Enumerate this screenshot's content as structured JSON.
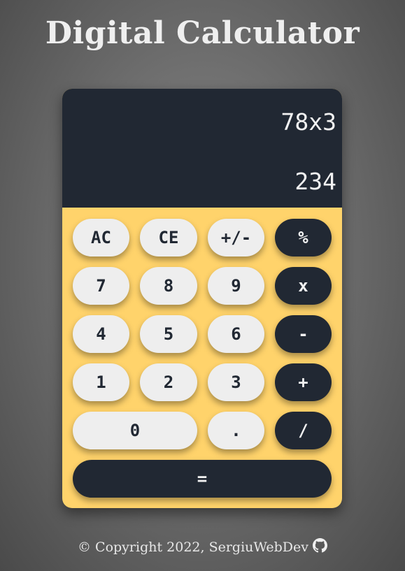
{
  "page": {
    "title": "Digital Calculator"
  },
  "display": {
    "expression": "78x3",
    "result": "234"
  },
  "keys": {
    "ac": "AC",
    "ce": "CE",
    "sign": "+/-",
    "percent": "%",
    "seven": "7",
    "eight": "8",
    "nine": "9",
    "multiply": "x",
    "four": "4",
    "five": "5",
    "six": "6",
    "subtract": "-",
    "one": "1",
    "two": "2",
    "three": "3",
    "add": "+",
    "zero": "0",
    "decimal": ".",
    "divide": "/",
    "equals": "="
  },
  "footer": {
    "text": "© Copyright 2022, SergiuWebDev",
    "icon": "github-icon"
  },
  "colors": {
    "display_bg": "#212833",
    "keypad_bg": "#ffd36b",
    "light_key": "#eeeeee",
    "dark_key": "#212833"
  }
}
